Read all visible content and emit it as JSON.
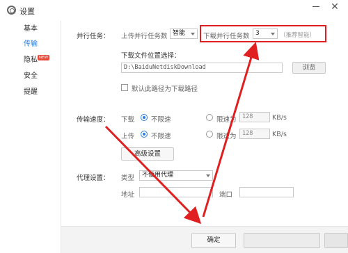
{
  "window": {
    "title": "设置"
  },
  "sidebar": {
    "items": [
      {
        "label": "基本"
      },
      {
        "label": "传输"
      },
      {
        "label": "隐私"
      },
      {
        "label": "安全"
      },
      {
        "label": "提醒"
      }
    ],
    "new_badge": "NEW",
    "active_index": 1
  },
  "parallel": {
    "section_label": "并行任务：",
    "upload_label": "上传并行任务数",
    "upload_value": "智能",
    "download_label": "下载并行任务数",
    "download_value": "3",
    "recommend": "（推荐智能）"
  },
  "download_location": {
    "label": "下载文件位置选择：",
    "path": "D:\\BaiduNetdiskDownload",
    "browse": "浏览",
    "default_checkbox": "默认此路径为下载路径",
    "default_checked": false
  },
  "speed": {
    "section_label": "传输速度：",
    "download_label": "下载",
    "upload_label": "上传",
    "unlimited": "不限速",
    "limit_to": "限速为",
    "download_limit": "128",
    "upload_limit": "128",
    "unit": "KB/s",
    "advanced": "高级设置"
  },
  "proxy": {
    "section_label": "代理设置：",
    "type_label": "类型",
    "type_value": "不使用代理",
    "address_label": "地址",
    "port_label": "端口",
    "address_value": "",
    "port_value": ""
  },
  "footer": {
    "ok": "确定"
  },
  "colors": {
    "accent": "#2a7fe0",
    "annotation": "#e02020",
    "badge": "#e84a3a"
  }
}
